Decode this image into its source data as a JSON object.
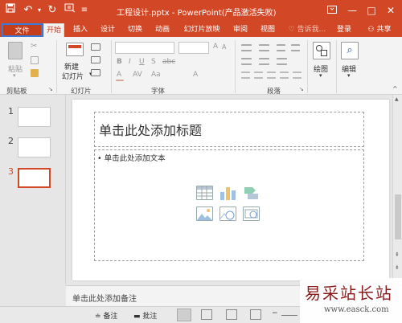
{
  "window": {
    "title": "工程设计.pptx - PowerPoint(产品激活失败)"
  },
  "quick_access": {
    "save_icon": "save-icon",
    "undo_icon": "undo-icon",
    "redo_icon": "redo-icon",
    "customize_icon": "customize-icon"
  },
  "tabs": [
    {
      "label": "文件"
    },
    {
      "label": "开始"
    },
    {
      "label": "插入"
    },
    {
      "label": "设计"
    },
    {
      "label": "切换"
    },
    {
      "label": "动画"
    },
    {
      "label": "幻灯片放映"
    },
    {
      "label": "审阅"
    },
    {
      "label": "视图"
    }
  ],
  "tell_me": "告诉我...",
  "login": "登录",
  "share": "共享",
  "ribbon": {
    "clipboard": {
      "paste": "粘贴",
      "label": "剪贴板"
    },
    "slides": {
      "new_slide_line1": "新建",
      "new_slide_line2": "幻灯片",
      "label": "幻灯片"
    },
    "font": {
      "label": "字体"
    },
    "paragraph": {
      "label": "段落"
    },
    "drawing": {
      "label": "绘图"
    },
    "editing": {
      "label": "编辑"
    }
  },
  "thumbnails": [
    {
      "number": "1"
    },
    {
      "number": "2"
    },
    {
      "number": "3"
    }
  ],
  "slide": {
    "title_placeholder": "单击此处添加标题",
    "content_placeholder": "• 单击此处添加文本"
  },
  "notes": {
    "placeholder": "单击此处添加备注"
  },
  "status": {
    "notes": "备注",
    "comments": "批注"
  },
  "watermark": {
    "line1": "易采站长站",
    "line2": "www.easck.com"
  },
  "colors": {
    "accent": "#d24726",
    "file_tab_border": "#3a7bd5"
  }
}
